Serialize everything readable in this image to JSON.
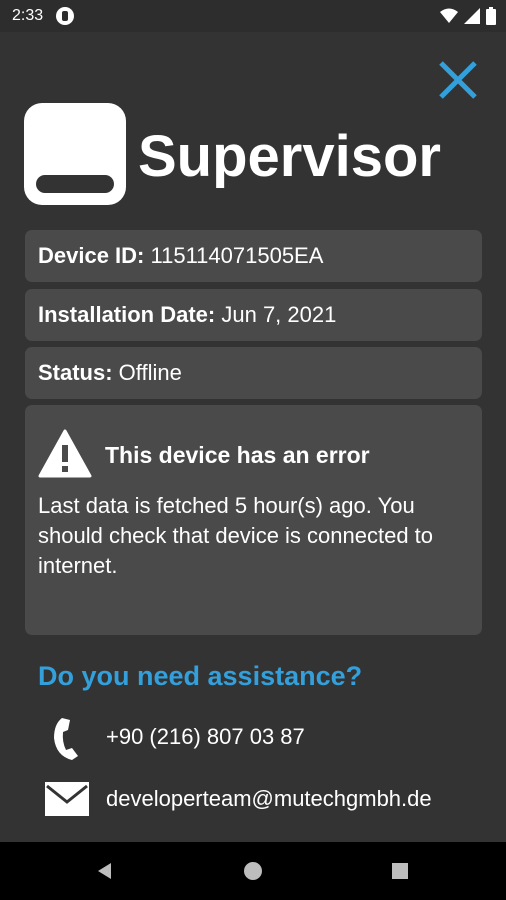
{
  "status_bar": {
    "time": "2:33"
  },
  "header": {
    "title": "Supervisor"
  },
  "device": {
    "id_label": "Device ID:",
    "id_value": " 115114071505EA",
    "install_label": "Installation Date:",
    "install_value": " Jun 7, 2021",
    "status_label": "Status:",
    "status_value": " Offline"
  },
  "error": {
    "title": "This device has an error",
    "message": "Last data is fetched 5 hour(s) ago. You should check that device is connected to internet."
  },
  "assistance": {
    "heading": "Do you need assistance?",
    "phone": "+90 (216) 807 03 87",
    "email": "developerteam@mutechgmbh.de"
  },
  "colors": {
    "accent": "#33a0dc",
    "background": "#333333",
    "card": "#4a4a4a"
  },
  "icons": [
    "close-icon",
    "warning-icon",
    "phone-icon",
    "mail-icon"
  ]
}
